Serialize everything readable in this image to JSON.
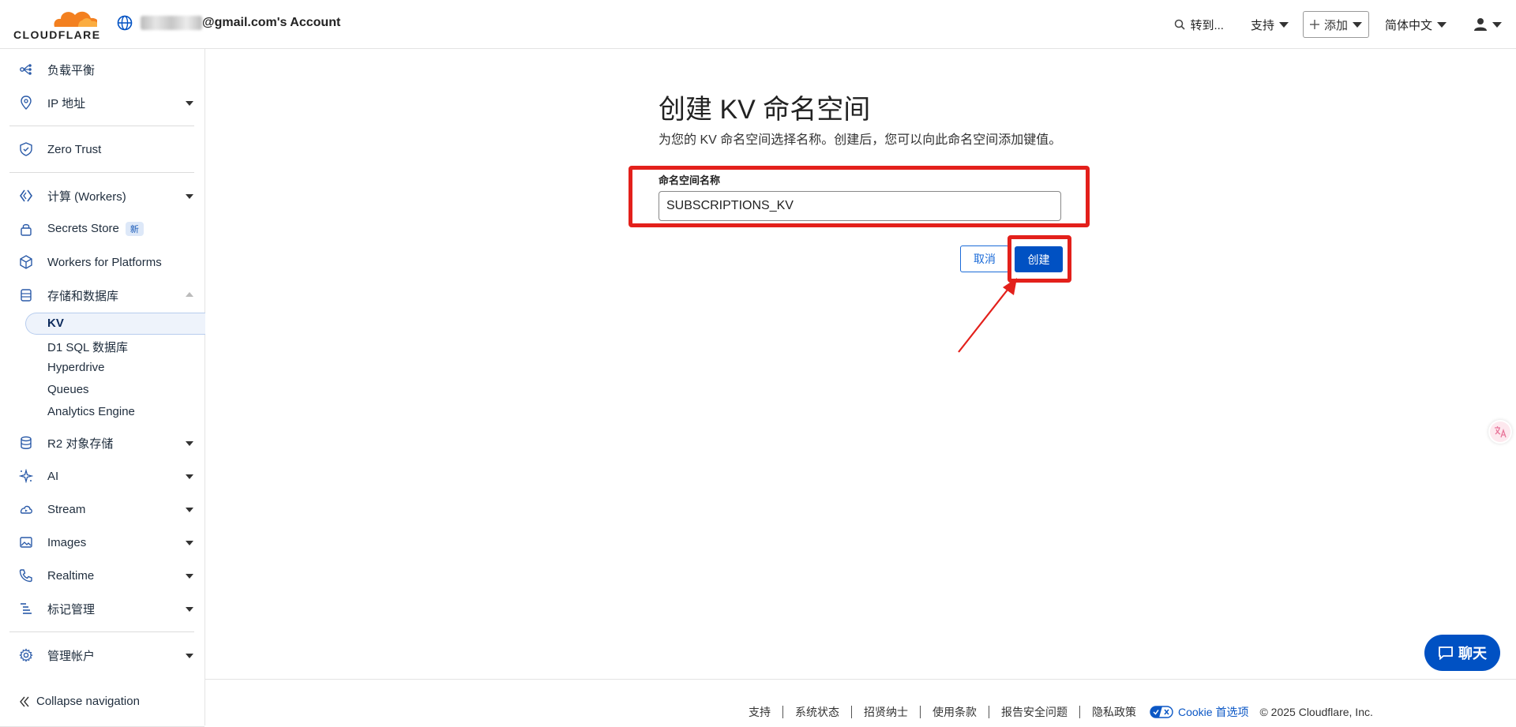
{
  "header": {
    "logo_text": "CLOUDFLARE",
    "account_suffix": "@gmail.com's Account",
    "search_label": "转到...",
    "support_label": "支持",
    "add_label": "添加",
    "language_label": "简体中文"
  },
  "sidebar": {
    "items": [
      {
        "label": "负载平衡"
      },
      {
        "label": "IP 地址"
      },
      {
        "label": "Zero Trust"
      },
      {
        "label": "计算 (Workers)"
      },
      {
        "label": "Secrets Store",
        "badge": "新"
      },
      {
        "label": "Workers for Platforms"
      },
      {
        "label": "存储和数据库"
      },
      {
        "label": "R2 对象存储"
      },
      {
        "label": "AI"
      },
      {
        "label": "Stream"
      },
      {
        "label": "Images"
      },
      {
        "label": "Realtime"
      },
      {
        "label": "标记管理"
      },
      {
        "label": "管理帐户"
      }
    ],
    "storage_children": [
      "KV",
      "D1 SQL 数据库",
      "Hyperdrive",
      "Queues",
      "Analytics Engine"
    ],
    "collapse_label": "Collapse navigation"
  },
  "main": {
    "title": "创建 KV 命名空间",
    "subtitle": "为您的 KV 命名空间选择名称。创建后，您可以向此命名空间添加键值。",
    "field_label": "命名空间名称",
    "field_value": "SUBSCRIPTIONS_KV",
    "cancel_label": "取消",
    "create_label": "创建"
  },
  "footer": {
    "links": [
      "支持",
      "系统状态",
      "招贤纳士",
      "使用条款",
      "报告安全问题",
      "隐私政策"
    ],
    "cookie_label": "Cookie 首选项",
    "copyright": "© 2025 Cloudflare, Inc."
  },
  "chat_label": "聊天",
  "colors": {
    "accent": "#0051c3",
    "highlight": "#e3201b",
    "logo_orange": "#f38020"
  }
}
